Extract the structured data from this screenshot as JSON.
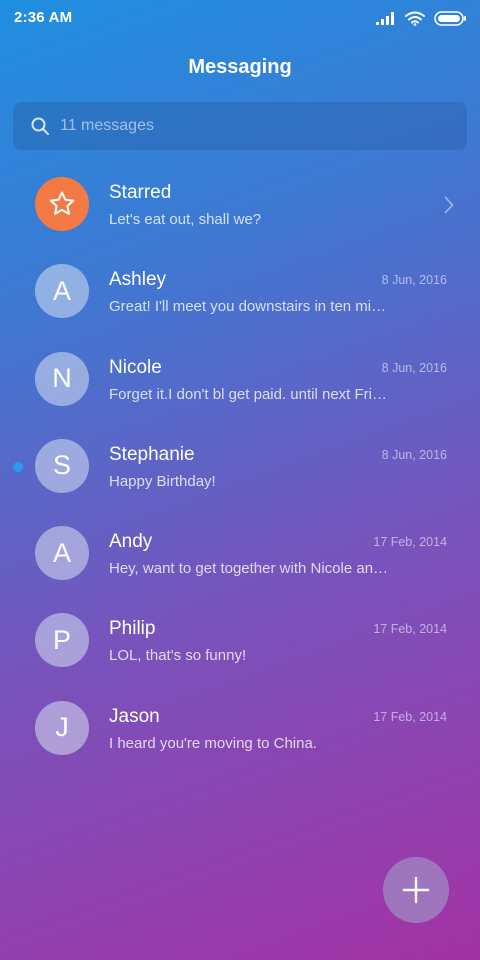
{
  "status_bar": {
    "time": "2:36 AM",
    "icons": [
      "signal-icon",
      "wifi-icon",
      "battery-icon"
    ]
  },
  "header": {
    "title": "Messaging"
  },
  "search": {
    "icon": "search-icon",
    "placeholder": "11 messages"
  },
  "conversations": [
    {
      "name": "Starred",
      "preview": "Let's eat out, shall we?",
      "date": "",
      "avatar": "",
      "avatar_icon": "star-icon",
      "avatar_color": "#f37a44",
      "unread": false
    },
    {
      "name": "Ashley",
      "preview": "Great! I'll meet you downstairs in ten minutes.",
      "date": "8 Jun, 2016",
      "avatar": "A",
      "unread": false
    },
    {
      "name": "Nicole",
      "preview": "Forget it.I don't bl get paid. until next Friday",
      "date": "8 Jun, 2016",
      "avatar": "N",
      "unread": false
    },
    {
      "name": "Stephanie",
      "preview": "Happy Birthday!",
      "date": "8 Jun, 2016",
      "avatar": "S",
      "unread": true
    },
    {
      "name": "Andy",
      "preview": "Hey, want to get together with Nicole and me?",
      "date": "17 Feb, 2014",
      "avatar": "A",
      "unread": false
    },
    {
      "name": "Philip",
      "preview": "LOL, that's so funny!",
      "date": "17 Feb, 2014",
      "avatar": "P",
      "unread": false
    },
    {
      "name": "Jason",
      "preview": "I heard you're moving to China.",
      "date": "17 Feb, 2014",
      "avatar": "J",
      "unread": false
    }
  ],
  "fab": {
    "icon": "plus-icon"
  },
  "colors": {
    "gradient_start": "#1f8fe0",
    "gradient_end": "#a332a4",
    "starred_avatar": "#f37a44",
    "unread_dot": "#2a9af2"
  }
}
